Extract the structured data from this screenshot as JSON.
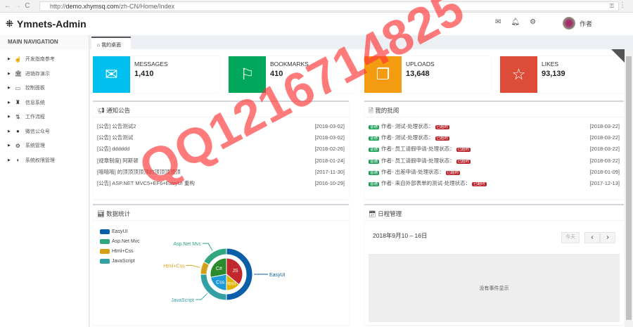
{
  "browser": {
    "url_prefix": "http://",
    "url_host": "demo.xhymsq.com",
    "url_path": "/zh-CN/Home/Index"
  },
  "app": {
    "title": "Ymnets-Admin",
    "user": "作者"
  },
  "sidebar": {
    "heading": "MAIN NAVIGATION",
    "items": [
      {
        "label": "开发指南参考",
        "icon": "hand-pointer-icon",
        "glyph": "☝"
      },
      {
        "label": "进销存演示",
        "icon": "bank-icon",
        "glyph": "🏛"
      },
      {
        "label": "控制面板",
        "icon": "desktop-icon",
        "glyph": "▭"
      },
      {
        "label": "信息系统",
        "icon": "sitemap-icon",
        "glyph": "♜"
      },
      {
        "label": "工作流程",
        "icon": "sort-icon",
        "glyph": "⇅"
      },
      {
        "label": "微信公众号",
        "icon": "wechat-icon",
        "glyph": "●"
      },
      {
        "label": "系统管理",
        "icon": "gears-icon",
        "glyph": "⚙"
      },
      {
        "label": "系统权限管理",
        "icon": "shield-icon",
        "glyph": "◗"
      }
    ]
  },
  "tab": {
    "label": "我的桌面"
  },
  "stats": [
    {
      "label": "MESSAGES",
      "value": "1,410",
      "color": "#00c0ef",
      "icon": "envelope-icon"
    },
    {
      "label": "BOOKMARKS",
      "value": "410",
      "color": "#00a65a",
      "icon": "flag-icon"
    },
    {
      "label": "UPLOADS",
      "value": "13,648",
      "color": "#f39c12",
      "icon": "files-icon"
    },
    {
      "label": "LIKES",
      "value": "93,139",
      "color": "#dd4b39",
      "icon": "star-icon"
    }
  ],
  "notices": {
    "title": "通知公告",
    "rows": [
      {
        "text": "[公告] 公告测试2",
        "date": "[2018-03-02]"
      },
      {
        "text": "[公告] 公告测试",
        "date": "[2018-03-02]"
      },
      {
        "text": "[公告] dddddd",
        "date": "[2018-02-26]"
      },
      {
        "text": "[规章制度] 阿斯顿",
        "date": "[2018-01-24]"
      },
      {
        "text": "[嘻嘻嘻] 的顶顶顶顶顶的顶顶顶顶顶",
        "date": "[2017-11-30]"
      },
      {
        "text": "[公告] ASP.NET MVC5+EF6+EasyUI 重构",
        "date": "[2016-10-29]"
      }
    ]
  },
  "approvals": {
    "title": "我的批阅",
    "badge": "普通",
    "status_badge": "已超时",
    "rows": [
      {
        "text": "作者- 测试-处理状态：",
        "date": "[2018-03-22]"
      },
      {
        "text": "作者- 测试-处理状态：",
        "date": "[2018-03-22]"
      },
      {
        "text": "作者- 员工请假申请-处理状态：",
        "date": "[2018-03-22]"
      },
      {
        "text": "作者- 员工请假申请-处理状态：",
        "date": "[2018-03-22]"
      },
      {
        "text": "作者- 出差申请-处理状态：",
        "date": "[2018-01-09]"
      },
      {
        "text": "作者- 来自外部表单的测试-处理状态：",
        "date": "[2017-12-13]"
      }
    ]
  },
  "stats_panel": {
    "title": "数据统计"
  },
  "chart_data": {
    "type": "pie",
    "title": "数据统计",
    "outer": {
      "categories": [
        "EasyUI",
        "JavaScript",
        "Html+Css",
        "Asp.Net Mvc"
      ],
      "values": [
        50,
        25,
        8,
        17
      ],
      "colors": [
        "#0a5fa8",
        "#34a0a4",
        "#d4a017",
        "#2fa67f"
      ]
    },
    "inner": {
      "categories": [
        "JS",
        "Html",
        "Css",
        "C#"
      ],
      "values": [
        36,
        14,
        22,
        28
      ],
      "colors": [
        "#c1272d",
        "#e0b400",
        "#1e9ad6",
        "#2b8a2b"
      ]
    },
    "legend": [
      "EasyUI",
      "Asp.Net Mvc",
      "Html+Css",
      "JavaScript"
    ],
    "legend_colors": [
      "#0a5fa8",
      "#2fa67f",
      "#d4a017",
      "#34a0a4"
    ],
    "legend_position": "top-left"
  },
  "calendar": {
    "title": "日程管理",
    "range": "2018年9月10 – 16日",
    "today": "今天",
    "prev": "‹",
    "next": "›",
    "empty": "没有事件显示"
  },
  "watermark": "QQ1216714825"
}
